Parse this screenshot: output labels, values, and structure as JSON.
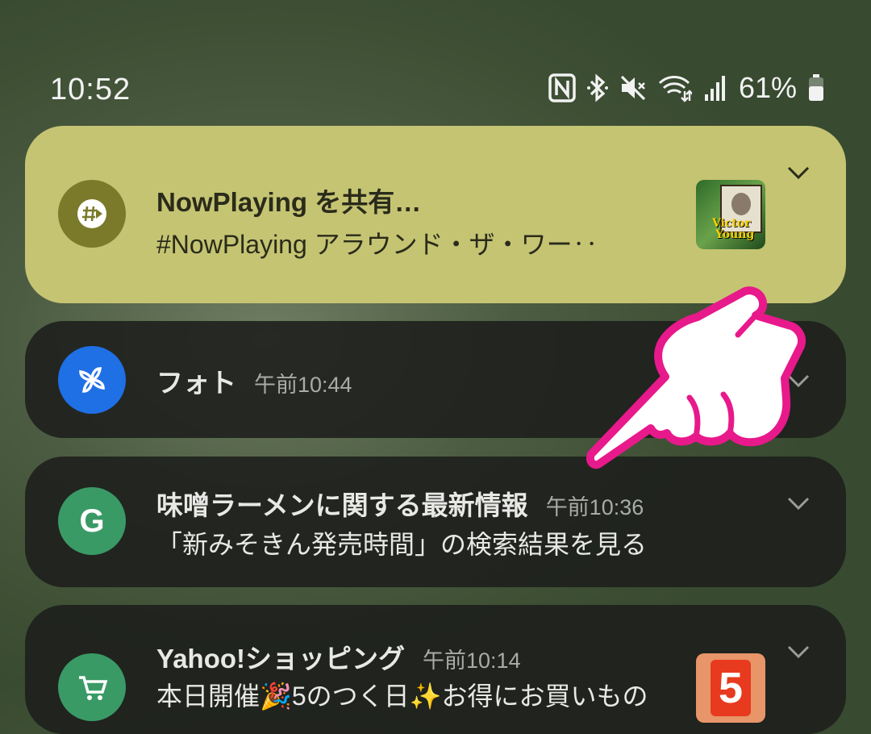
{
  "status_bar": {
    "time": "10:52",
    "battery_percent": "61%",
    "icons": [
      "nfc-icon",
      "bluetooth-icon",
      "mute-icon",
      "wifi-icon",
      "signal-icon",
      "battery-icon"
    ]
  },
  "notifications": [
    {
      "app_icon": "hash-share-icon",
      "title": "NowPlaying を共有…",
      "body": "#NowPlaying アラウンド・ザ・ワー‥",
      "thumbnail_text": [
        "Victor",
        "Young"
      ],
      "accent": "#c5c473"
    },
    {
      "app_icon": "pinwheel-icon",
      "title": "フォト",
      "time": "午前10:44",
      "accent": "#1f6fe5"
    },
    {
      "app_icon": "google-g-icon",
      "title": "味噌ラーメンに関する最新情報",
      "time": "午前10:36",
      "body": "「新みそきん発売時間」の検索結果を見る",
      "accent": "#3a9a66"
    },
    {
      "app_icon": "shopping-cart-icon",
      "title": "Yahoo!ショッピング",
      "time": "午前10:14",
      "body": "本日開催🎉5のつく日✨お得にお買いもの",
      "thumbnail_text": [
        "5"
      ],
      "accent": "#3a9a66"
    }
  ]
}
